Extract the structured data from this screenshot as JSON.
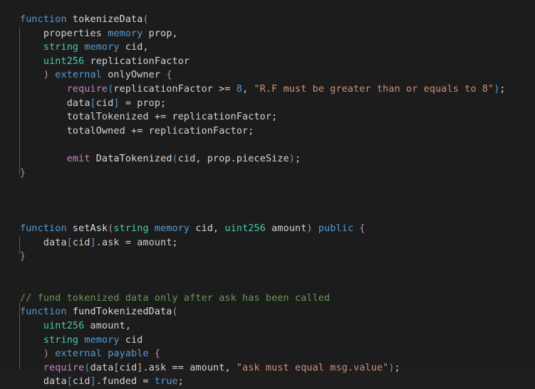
{
  "editor": {
    "language": "solidity",
    "background": "#1c1c1c",
    "foreground": "#d4d4d4",
    "font_size_px": 13.4,
    "line_height_px": 19.6,
    "colors": {
      "keyword": "#569cd6",
      "type": "#4ec9b0",
      "string": "#ce9178",
      "number": "#569cd6",
      "comment": "#6a9955",
      "control": "#c586c0",
      "bracket_level_1": "#c586c0",
      "bracket_level_2": "#569cd6",
      "bracket_level_3": "#d7ba7d",
      "indent_guide": "#7d7d7d"
    },
    "lines": [
      "    function tokenizeData(",
      "        properties memory prop,",
      "        string memory cid,",
      "        uint256 replicationFactor",
      "        ) external onlyOwner {",
      "            require(replicationFactor >= 8, \"R.F must be greater than or equals to 8\");",
      "            data[cid] = prop;",
      "            totalTokenized += replicationFactor;",
      "            totalOwned += replicationFactor;",
      "",
      "            emit DataTokenized(cid, prop.pieceSize);",
      "    }",
      "",
      "",
      "    function setAsk(string memory cid, uint256 amount) public {",
      "        data[cid].ask = amount;",
      "    }",
      "",
      "    // fund tokenized data only after ask has been called",
      "    function fundTokenizedData(",
      "        uint256 amount,",
      "        string memory cid",
      "        ) external payable {",
      "        require(data[cid].ask == amount, \"ask must equal msg.value\");",
      "        data[cid].funded = true;"
    ],
    "strings": [
      "\"R.F must be greater than or equals to 8\"",
      "\"ask must equal msg.value\""
    ],
    "comments": [
      "// fund tokenized data only after ask has been called"
    ],
    "identifiers": [
      "tokenizeData",
      "properties",
      "prop",
      "cid",
      "replicationFactor",
      "onlyOwner",
      "data",
      "totalTokenized",
      "totalOwned",
      "DataTokenized",
      "pieceSize",
      "setAsk",
      "amount",
      "ask",
      "fundTokenizedData",
      "funded"
    ],
    "keywords": [
      "function",
      "memory",
      "external",
      "public",
      "payable",
      "true",
      "require",
      "emit"
    ],
    "types": [
      "string",
      "uint256"
    ],
    "numbers": [
      "8"
    ]
  }
}
